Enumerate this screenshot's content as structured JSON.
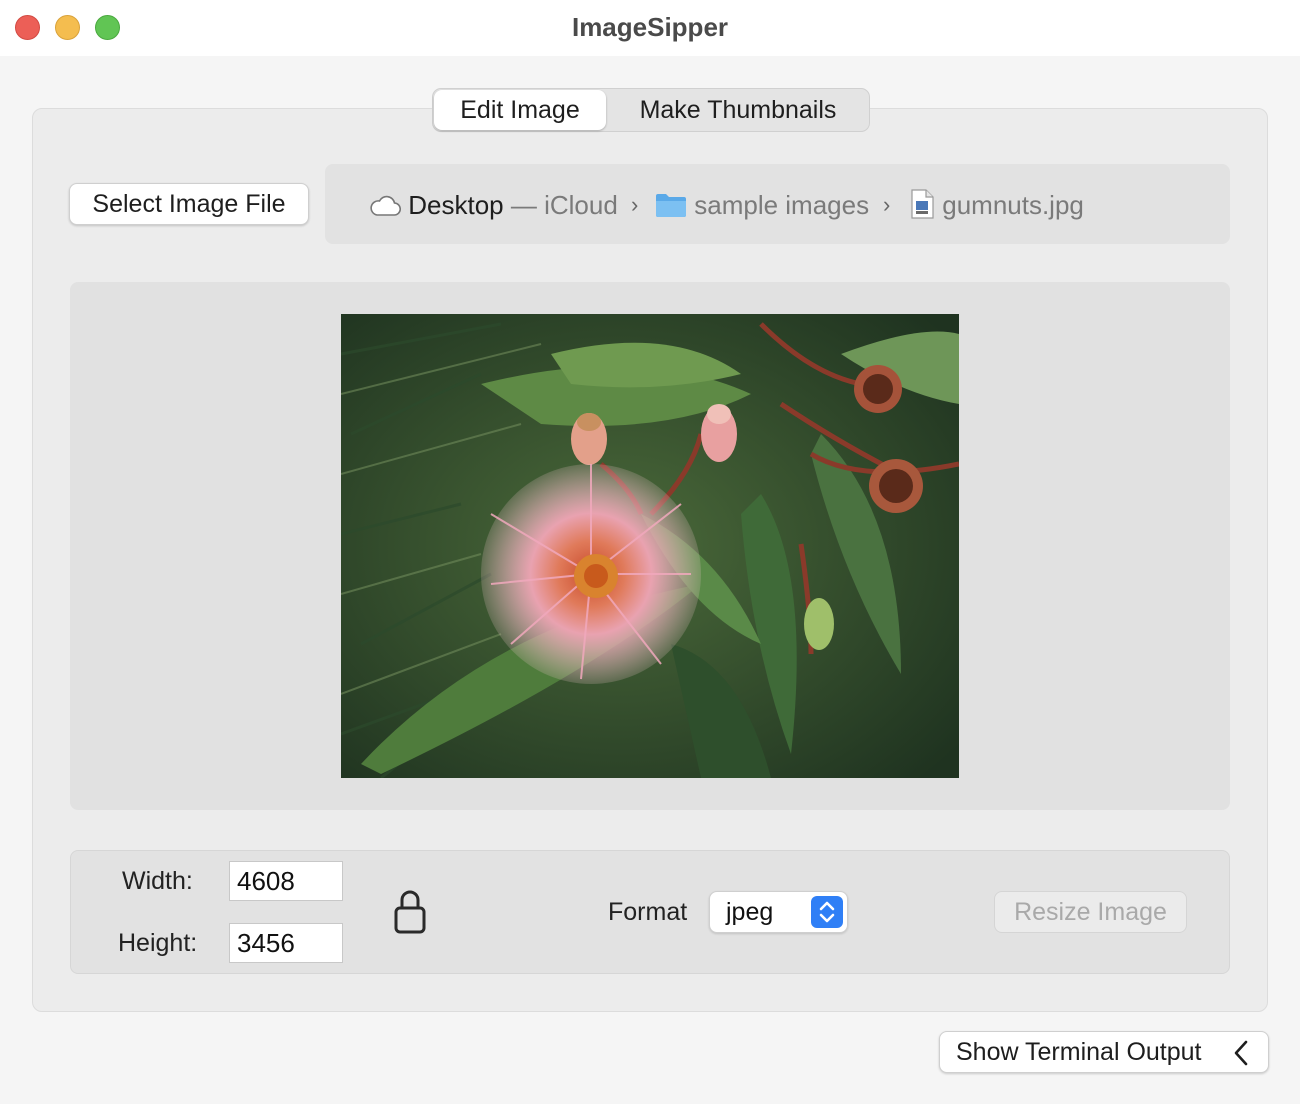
{
  "window": {
    "title": "ImageSipper",
    "buttons": [
      "close",
      "minimize",
      "zoom"
    ]
  },
  "tabs": [
    {
      "label": "Edit Image",
      "selected": true
    },
    {
      "label": "Make Thumbnails",
      "selected": false
    }
  ],
  "file_picker": {
    "button_label": "Select Image File",
    "path": [
      {
        "icon": "cloud-icon",
        "label": "Desktop",
        "suffix": " — iCloud"
      },
      {
        "icon": "folder-icon",
        "label": "sample images"
      },
      {
        "icon": "image-file-icon",
        "label": "gumnuts.jpg"
      }
    ],
    "separator": "›"
  },
  "preview": {
    "description_icon": "photo-of-gum-blossom-and-gumnuts"
  },
  "size": {
    "width_label": "Width:",
    "width_value": "4608",
    "height_label": "Height:",
    "height_value": "3456",
    "lock_icon": "lock-open-icon"
  },
  "format": {
    "label": "Format",
    "value": "jpeg"
  },
  "resize_button": {
    "label": "Resize Image",
    "enabled": false
  },
  "terminal_button": {
    "label": "Show Terminal Output",
    "icon": "chevron-left-icon"
  },
  "colors": {
    "accent": "#2f7ff6",
    "close": "#ec5f57",
    "minimize": "#f4bd4f",
    "zoom": "#61c554"
  }
}
